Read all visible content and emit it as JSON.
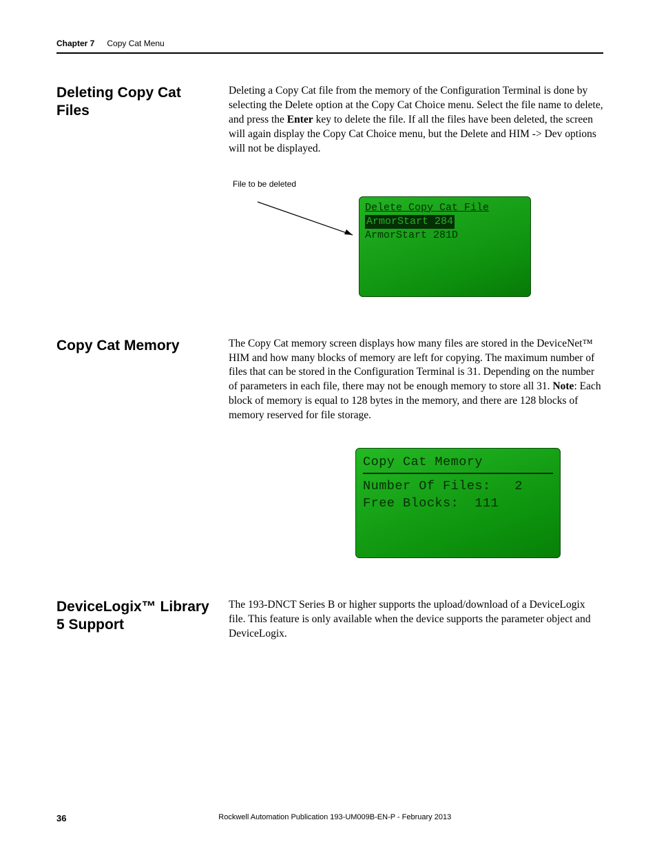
{
  "header": {
    "chapter_label": "Chapter 7",
    "chapter_title": "Copy Cat Menu"
  },
  "sections": {
    "deleting": {
      "heading": "Deleting Copy Cat Files",
      "body_pre": "Deleting a Copy Cat file from the memory of the Configuration Terminal is done by selecting the Delete option at the Copy Cat Choice menu. Select the file name to delete, and press the ",
      "enter": "Enter",
      "body_post": " key to delete the file. If all the files have been deleted, the screen will again display the Copy Cat Choice menu, but the Delete and HIM -> Dev options will not be displayed.",
      "caption": "File to be deleted",
      "screen": {
        "title": "Delete Copy Cat File",
        "selected": "ArmorStart 284",
        "other": "ArmorStart 281D"
      }
    },
    "memory": {
      "heading": "Copy Cat Memory",
      "body_pre": "The Copy Cat memory screen displays how many files are stored in the DeviceNet™ HIM and how many blocks of memory are left for copying. The maximum number of files that can be stored in the Configuration Terminal is 31. Depending on the number of parameters in each file, there may not be enough memory to store all 31. ",
      "note": "Note",
      "body_post": ": Each block of memory is equal to 128 bytes in the memory, and there are 128 blocks of memory reserved for file storage.",
      "screen": {
        "title": "Copy Cat Memory",
        "line1": "Number Of Files:   2",
        "line2": "Free Blocks:  111"
      }
    },
    "devicelogix": {
      "heading": "DeviceLogix™ Library 5 Support",
      "body": "The 193-DNCT Series B or higher supports the upload/download of a DeviceLogix file. This feature is only available when the device supports the parameter object and DeviceLogix."
    }
  },
  "footer": {
    "page_number": "36",
    "publication": "Rockwell Automation Publication 193-UM009B-EN-P - February 2013"
  }
}
